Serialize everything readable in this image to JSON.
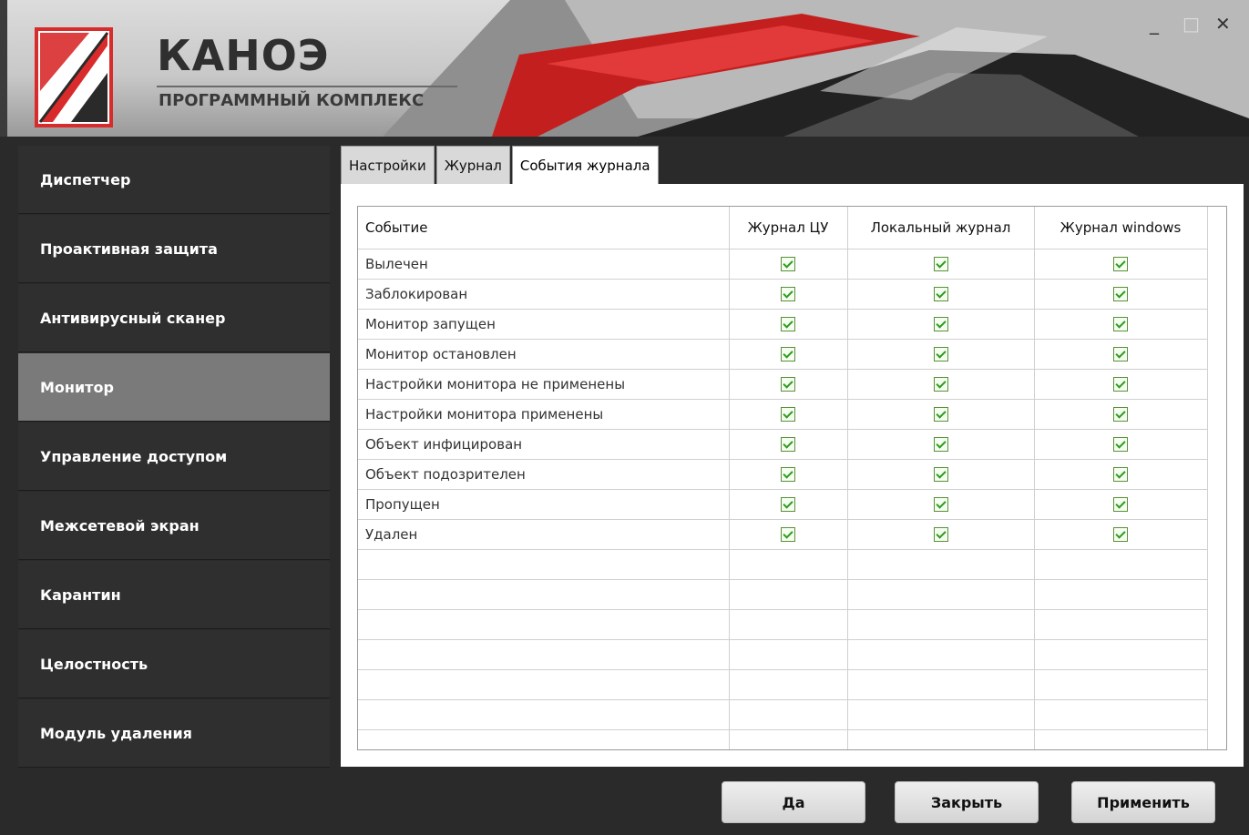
{
  "app": {
    "brand": "КАНОЭ",
    "subtitle": "ПРОГРАММНЫЙ КОМПЛЕКС",
    "accent_color": "#d92b2b"
  },
  "window_controls": {
    "minimize": "_",
    "maximize": "□",
    "close": "✕"
  },
  "nav": {
    "items": [
      {
        "label": "Диспетчер"
      },
      {
        "label": "Проактивная защита"
      },
      {
        "label": "Антивирусный сканер"
      },
      {
        "label": "Монитор",
        "active": true
      },
      {
        "label": "Управление доступом"
      },
      {
        "label": "Межсетевой экран"
      },
      {
        "label": "Карантин"
      },
      {
        "label": "Целостность"
      },
      {
        "label": "Модуль удаления"
      }
    ]
  },
  "tabs": [
    {
      "label": "Настройки"
    },
    {
      "label": "Журнал"
    },
    {
      "label": "События журнала",
      "active": true
    }
  ],
  "table": {
    "columns": [
      "Событие",
      "Журнал ЦУ",
      "Локальный журнал",
      "Журнал windows"
    ],
    "rows": [
      {
        "event": "Вылечен",
        "cu": true,
        "local": true,
        "windows": true
      },
      {
        "event": "Заблокирован",
        "cu": true,
        "local": true,
        "windows": true
      },
      {
        "event": "Монитор запущен",
        "cu": true,
        "local": true,
        "windows": true
      },
      {
        "event": "Монитор остановлен",
        "cu": true,
        "local": true,
        "windows": true
      },
      {
        "event": "Настройки монитора не применены",
        "cu": true,
        "local": true,
        "windows": true
      },
      {
        "event": "Настройки монитора применены",
        "cu": true,
        "local": true,
        "windows": true
      },
      {
        "event": "Объект инфицирован",
        "cu": true,
        "local": true,
        "windows": true
      },
      {
        "event": "Объект подозрителен",
        "cu": true,
        "local": true,
        "windows": true
      },
      {
        "event": "Пропущен",
        "cu": true,
        "local": true,
        "windows": true
      },
      {
        "event": "Удален",
        "cu": true,
        "local": true,
        "windows": true
      }
    ]
  },
  "buttons": {
    "ok": "Да",
    "close": "Закрыть",
    "apply": "Применить"
  }
}
